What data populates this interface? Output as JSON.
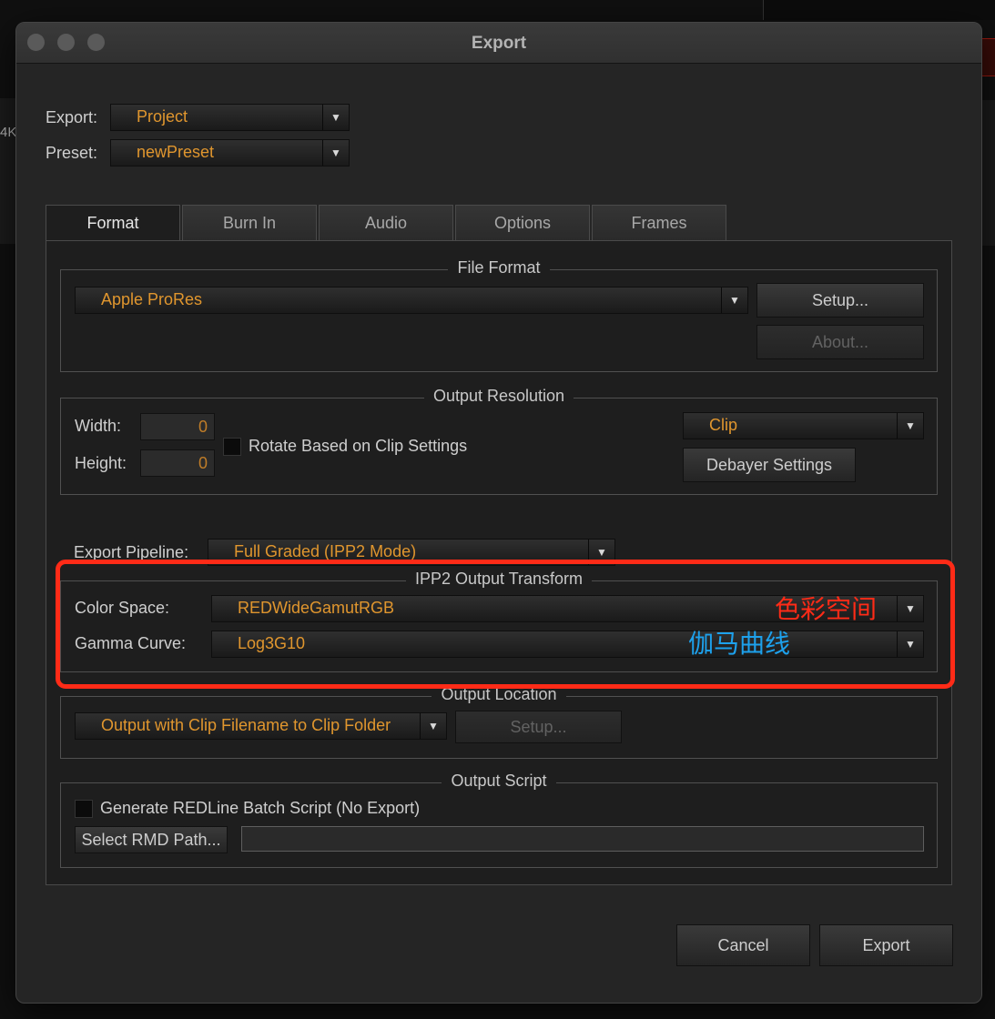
{
  "background": {
    "fragment": "4K"
  },
  "window": {
    "title": "Export"
  },
  "export": {
    "label": "Export:",
    "value": "Project"
  },
  "preset": {
    "label": "Preset:",
    "value": "newPreset"
  },
  "tabs": [
    {
      "label": "Format"
    },
    {
      "label": "Burn In"
    },
    {
      "label": "Audio"
    },
    {
      "label": "Options"
    },
    {
      "label": "Frames"
    }
  ],
  "file_format": {
    "title": "File Format",
    "value": "Apple ProRes",
    "setup_label": "Setup...",
    "about_label": "About..."
  },
  "output_resolution": {
    "title": "Output Resolution",
    "width_label": "Width:",
    "width_value": "0",
    "height_label": "Height:",
    "height_value": "0",
    "rotate_label": "Rotate Based on Clip Settings",
    "resolution_value": "Clip",
    "debayer_label": "Debayer Settings"
  },
  "pipeline": {
    "label": "Export Pipeline:",
    "value": "Full Graded (IPP2 Mode)"
  },
  "ipp2": {
    "title": "IPP2 Output Transform",
    "color_space_label": "Color Space:",
    "color_space_value": "REDWideGamutRGB",
    "gamma_label": "Gamma Curve:",
    "gamma_value": "Log3G10"
  },
  "annotations": {
    "color_space": "色彩空间",
    "gamma": "伽马曲线"
  },
  "output_location": {
    "title": "Output Location",
    "value": "Output with Clip Filename to Clip Folder",
    "setup_label": "Setup..."
  },
  "output_script": {
    "title": "Output Script",
    "generate_label": "Generate REDLine Batch Script (No Export)",
    "select_path_label": "Select RMD Path...",
    "path_value": ""
  },
  "footer": {
    "cancel_label": "Cancel",
    "export_label": "Export"
  },
  "colors": {
    "accent_value": "#e0962e",
    "annotation_red": "#ff2b17",
    "annotation_cyan": "#1da1ec"
  }
}
